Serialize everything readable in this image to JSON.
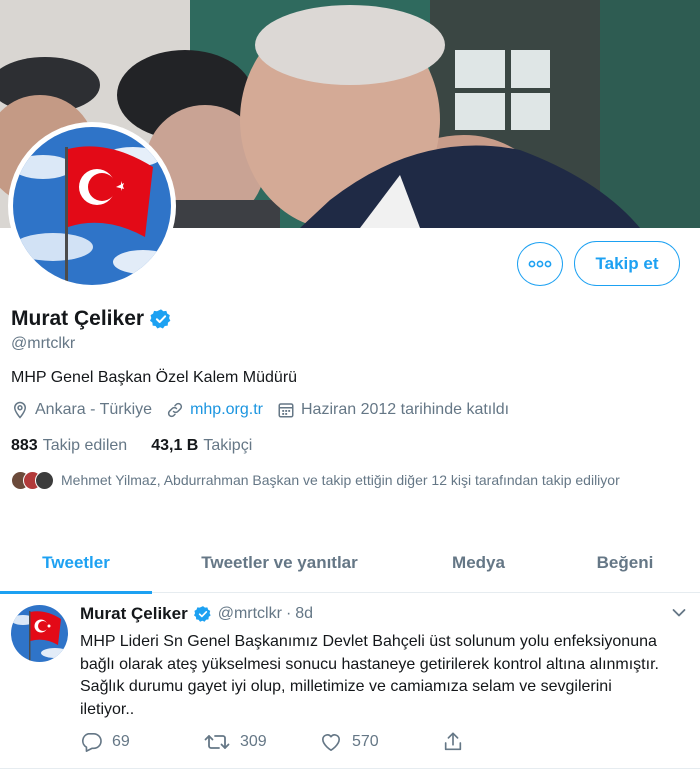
{
  "profile": {
    "name": "Murat Çeliker",
    "handle": "@mrtclkr",
    "bio": "MHP Genel Başkan Özel Kalem Müdürü",
    "location": "Ankara - Türkiye",
    "website": "mhp.org.tr",
    "joined": "Haziran 2012 tarihinde katıldı"
  },
  "actions": {
    "follow_label": "Takip et"
  },
  "stats": {
    "following_count": "883",
    "following_label": "Takip edilen",
    "followers_count": "43,1 B",
    "followers_label": "Takipçi"
  },
  "followed_by": {
    "text": "Mehmet Yilmaz, Abdurrahman Başkan ve takip ettiğin diğer 12 kişi tarafından takip ediliyor"
  },
  "tabs": [
    {
      "label": "Tweetler",
      "active": true
    },
    {
      "label": "Tweetler ve yanıtlar",
      "active": false
    },
    {
      "label": "Medya",
      "active": false
    },
    {
      "label": "Beğeni",
      "active": false
    }
  ],
  "tweet": {
    "name": "Murat Çeliker",
    "handle": "@mrtclkr",
    "separator": "·",
    "time": "8d",
    "text": "MHP Lideri Sn Genel Başkanımız Devlet Bahçeli üst solunum yolu enfeksiyonuna bağlı olarak ateş yükselmesi sonucu hastaneye getirilerek kontrol altına alınmıştır. Sağlık durumu gayet iyi olup, milletimize ve camiamıza selam ve sevgilerini iletiyor..",
    "replies": "69",
    "retweets": "309",
    "likes": "570"
  },
  "colors": {
    "accent": "#1da1f2",
    "link": "#1b95e0",
    "secondary_text": "#657786",
    "primary_text": "#14171a",
    "flag_red": "#e30a17"
  },
  "icons": [
    "more-icon",
    "verified-icon",
    "location-icon",
    "link-icon",
    "calendar-icon",
    "reply-icon",
    "retweet-icon",
    "like-icon",
    "share-icon",
    "chevron-down-icon"
  ]
}
